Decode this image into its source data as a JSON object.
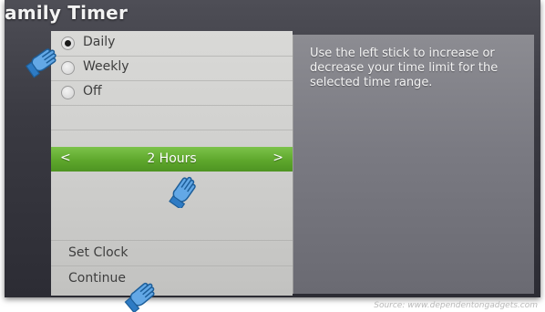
{
  "window": {
    "title": "amily Timer"
  },
  "options": [
    {
      "label": "Daily",
      "selected": true
    },
    {
      "label": "Weekly",
      "selected": false
    },
    {
      "label": "Off",
      "selected": false
    }
  ],
  "time_selector": {
    "value": "2 Hours",
    "left_arrow": "<",
    "right_arrow": ">"
  },
  "actions": {
    "set_clock": "Set Clock",
    "continue": "Continue"
  },
  "help": {
    "text": "Use the left stick to increase or decrease your time limit for the selected time range."
  },
  "footer": {
    "source": "Source: www.dependentongadgets.com"
  },
  "colors": {
    "accent_green": "#5ea72c",
    "panel_light": "#d2d2d0",
    "panel_dark": "#7a7a82",
    "hand_blue": "#63a8e6"
  },
  "icons": [
    "pointing-hand-icon",
    "radio-icon",
    "chevron-left-icon",
    "chevron-right-icon"
  ]
}
